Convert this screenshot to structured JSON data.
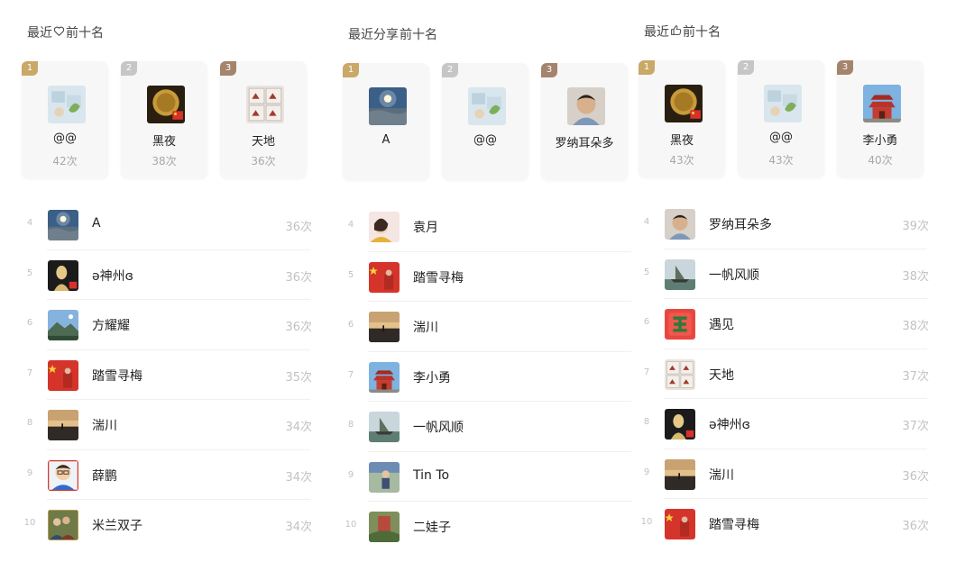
{
  "count_suffix": "次",
  "boards": [
    {
      "title_prefix": "最近",
      "title_icon": "heart-icon",
      "title_suffix": "前十名",
      "top3": [
        {
          "rank": "1",
          "name": "@@",
          "count": "42次",
          "avatar": "stamps"
        },
        {
          "rank": "2",
          "name": "黑夜",
          "count": "38次",
          "avatar": "coin"
        },
        {
          "rank": "3",
          "name": "天地",
          "count": "36次",
          "avatar": "horses"
        }
      ],
      "rows": [
        {
          "rank": "4",
          "name": "A",
          "count": "36次",
          "avatar": "sunset-sea"
        },
        {
          "rank": "5",
          "name": "ə神州ɞ",
          "count": "36次",
          "avatar": "portrait-gold"
        },
        {
          "rank": "6",
          "name": "方耀耀",
          "count": "36次",
          "avatar": "mountain"
        },
        {
          "rank": "7",
          "name": "踏雪寻梅",
          "count": "35次",
          "avatar": "flag"
        },
        {
          "rank": "8",
          "name": "湍川",
          "count": "34次",
          "avatar": "dusk"
        },
        {
          "rank": "9",
          "name": "薛鹏",
          "count": "34次",
          "avatar": "cartoon"
        },
        {
          "rank": "10",
          "name": "米兰双子",
          "count": "34次",
          "avatar": "group"
        }
      ]
    },
    {
      "title_prefix": "最近分享",
      "title_icon": "",
      "title_suffix": "前十名",
      "top3": [
        {
          "rank": "1",
          "name": "A",
          "count": "",
          "avatar": "sunset-sea"
        },
        {
          "rank": "2",
          "name": "@@",
          "count": "",
          "avatar": "stamps"
        },
        {
          "rank": "3",
          "name": "罗纳耳朵多",
          "count": "",
          "avatar": "child"
        }
      ],
      "rows": [
        {
          "rank": "4",
          "name": "袁月",
          "count": "",
          "avatar": "girl"
        },
        {
          "rank": "5",
          "name": "踏雪寻梅",
          "count": "",
          "avatar": "flag"
        },
        {
          "rank": "6",
          "name": "湍川",
          "count": "",
          "avatar": "dusk"
        },
        {
          "rank": "7",
          "name": "李小勇",
          "count": "",
          "avatar": "temple"
        },
        {
          "rank": "8",
          "name": "一帆风顺",
          "count": "",
          "avatar": "boat"
        },
        {
          "rank": "9",
          "name": "Tin To",
          "count": "",
          "avatar": "person"
        },
        {
          "rank": "10",
          "name": "二娃子",
          "count": "",
          "avatar": "garden"
        }
      ]
    },
    {
      "title_prefix": "最近",
      "title_icon": "thumbs-up-icon",
      "title_suffix": "前十名",
      "top3": [
        {
          "rank": "1",
          "name": "黑夜",
          "count": "43次",
          "avatar": "coin"
        },
        {
          "rank": "2",
          "name": "@@",
          "count": "43次",
          "avatar": "stamps"
        },
        {
          "rank": "3",
          "name": "李小勇",
          "count": "40次",
          "avatar": "temple"
        }
      ],
      "rows": [
        {
          "rank": "4",
          "name": "罗纳耳朵多",
          "count": "39次",
          "avatar": "child"
        },
        {
          "rank": "5",
          "name": "一帆风顺",
          "count": "38次",
          "avatar": "boat"
        },
        {
          "rank": "6",
          "name": "遇见",
          "count": "38次",
          "avatar": "red-logo"
        },
        {
          "rank": "7",
          "name": "天地",
          "count": "37次",
          "avatar": "horses"
        },
        {
          "rank": "8",
          "name": "ə神州ɞ",
          "count": "37次",
          "avatar": "portrait-gold"
        },
        {
          "rank": "9",
          "name": "湍川",
          "count": "36次",
          "avatar": "dusk"
        },
        {
          "rank": "10",
          "name": "踏雪寻梅",
          "count": "36次",
          "avatar": "flag"
        }
      ]
    }
  ]
}
